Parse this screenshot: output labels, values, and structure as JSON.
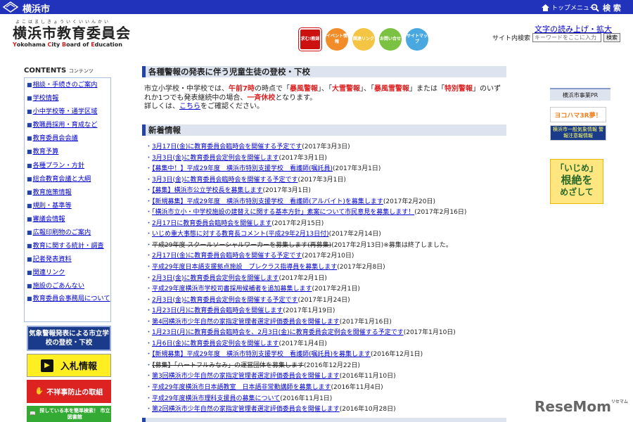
{
  "topbar": {
    "city": "横浜市",
    "top_menu": "トップメニュー",
    "search": "検 索"
  },
  "header": {
    "logo_ruby": "よこはましきょういくいいんかい",
    "logo_title": "横浜市教育委員会",
    "logo_en_1": "Y",
    "logo_en_2": "okohama ",
    "logo_en_3": "C",
    "logo_en_4": "ity ",
    "logo_en_5": "B",
    "logo_en_6": "oard of ",
    "logo_en_7": "E",
    "logo_en_8": "ducation",
    "icons": [
      {
        "label": "求む!教師",
        "color": "#cc1111"
      },
      {
        "label": "イベント情報",
        "color": "#f28c28"
      },
      {
        "label": "関連リンク",
        "color": "#f4c542"
      },
      {
        "label": "お問い合せ",
        "color": "#7cc242"
      },
      {
        "label": "サイトマップ",
        "color": "#4aa8e0"
      }
    ],
    "read_aloud": "文字の読み上げ・拡大",
    "site_search_label": "サイト内検索",
    "site_search_placeholder": "キーワードをここに入力",
    "site_search_button": "検索"
  },
  "left": {
    "contents_title": "CONTENTS",
    "contents_sub": "コンテンツ",
    "nav": [
      "相談・手続きのご案内",
      "学校情報",
      "小中学校等・通学区域",
      "教職員採用・育成など",
      "教育委員会会議",
      "教育予算",
      "各種プラン・方針",
      "総合教育会議と大綱",
      "教育施策情報",
      "規則・基準等",
      "審議会情報",
      "広報印刷物のご案内",
      "教育に関する統計・調査",
      "記者発表資料",
      "関連リンク",
      "施設のごあんない",
      "教育委員会事務局について"
    ],
    "banner_weather": "気象警報発表による市立学校の登校・下校",
    "banner_bid": "入札情報",
    "banner_misconduct": "不祥事防止の取組",
    "banner_library": "探している本を簡単検索！ 市立図書館"
  },
  "main": {
    "heading1": "各種警報の発表に伴う児童生徒の登校・下校",
    "notice": {
      "p1": "市立小学校・中学校では、",
      "p2": "午前7時",
      "p3": "の時点で「",
      "p4": "暴風警報",
      "p5": "」、「",
      "p6": "大雪警報",
      "p7": "」、「",
      "p8": "暴風雪警報",
      "p9": "」または「",
      "p10": "特別警報",
      "p11": "」のいず",
      "p12": "れか1つでも発表継続中の場合、",
      "p13": "一斉休校",
      "p14": "となります。",
      "p15": "詳しくは、",
      "p16": "こちら",
      "p17": "をご確認ください。"
    },
    "heading2": "新着情報",
    "news": [
      {
        "title": "3月17日(金)に教育委員会臨時会を開催する予定です",
        "date": "(2017年3月3日)",
        "del": false
      },
      {
        "title": "3月3日(金)に教育委員会定例会を開催します",
        "date": "(2017年3月1日)",
        "del": false
      },
      {
        "title": "【募集中！】平成29年度　横浜市特別支援学校　看護師(嘱託員)",
        "date": "(2017年3月1日)",
        "del": false
      },
      {
        "title": "3月3日(金)に教育委員会臨時会を開催する予定です",
        "date": "(2017年3月1日)",
        "del": false
      },
      {
        "title": "【募集】横浜市公立学校長を募集します",
        "date": "(2017年3月1日)",
        "del": false
      },
      {
        "title": "【新規募集】平成29年度　横浜市特別支援学校　看護師(アルバイト)を募集します",
        "date": "(2017年2月20日)",
        "del": false
      },
      {
        "title": "「横浜市立小・中学校施設の建替えに関する基本方針」素案について市民意見を募集します！",
        "date": "(2017年2月16日)",
        "del": false
      },
      {
        "title": "2月17日に教育委員会臨時会を開催します",
        "date": "(2017年2月15日)",
        "del": false
      },
      {
        "title": "いじめ重大事態に対する教育長コメント(平成29年2月13日付)",
        "date": "(2017年2月14日)",
        "del": false
      },
      {
        "title": "平成29年度 スクールソーシャルワーカーを募集します(再募集)",
        "date": "(2017年2月13日)※募集は終了しました。",
        "del": true
      },
      {
        "title": "2月17日(金)に教育委員会臨時会を開催する予定です",
        "date": "(2017年2月10日)",
        "del": false
      },
      {
        "title": "平成29年度日本語支援拠点施設　プレクラス指導員を募集します",
        "date": "(2017年2月8日)",
        "del": false
      },
      {
        "title": "2月3日(金)に教育委員会定例会を開催します",
        "date": "(2017年2月1日)",
        "del": false
      },
      {
        "title": "平成29年度横浜市学校司書採用候補者を追加募集します",
        "date": "(2017年2月1日)",
        "del": false
      },
      {
        "title": "2月3日(金)に教育委員会定例会を開催する予定です",
        "date": "(2017年1月24日)",
        "del": false
      },
      {
        "title": "1月23日(月)に教育委員会臨時会を開催します",
        "date": "(2017年1月19日)",
        "del": false
      },
      {
        "title": "第4回横浜市少年自然の家指定管理者選定評価委員会を開催します",
        "date": "(2017年1月16日)",
        "del": false
      },
      {
        "title": "1月23日(月)に教育委員会臨時会を、2月3日(金)に教育委員会定例会を開催する予定です",
        "date": "(2017年1月10日)",
        "del": false
      },
      {
        "title": "1月6日(金)に教育委員会定例会を開催します",
        "date": "(2017年1月4日)",
        "del": false
      },
      {
        "title": "【新規募集】平成29年度　横浜市特別支援学校　看護師(嘱託員)を募集します",
        "date": "(2016年12月1日)",
        "del": false
      },
      {
        "title": "【募集】「ハートフルみなみ」の運営団体を募集します",
        "date": "(2016年12月22日)",
        "del": true
      },
      {
        "title": "第3回横浜市少年自然の家指定管理者選定評価委員会を開催します",
        "date": "(2016年11月10日)",
        "del": false
      },
      {
        "title": "平成29年度横浜市日本語教室　日本語非常勤講師を募集します",
        "date": "(2016年11月4日)",
        "del": false
      },
      {
        "title": "平成29年度横浜市理科支援員の募集について",
        "date": "(2016年11月1日)",
        "del": false
      },
      {
        "title": "第2回横浜市少年自然の家指定管理者選定評価委員会を開催します",
        "date": "(2016年10月28日)",
        "del": false
      }
    ]
  },
  "right": {
    "pr_head": "横浜市事業PR",
    "pr1": "ヨコハマ3R夢！",
    "pr2": "横浜市一般気象情報 警報注意報情報",
    "pr3_line1": "「いじめ」",
    "pr3_line2": "根絶を",
    "pr3_line3": "めざして"
  },
  "watermark": "ReseMom",
  "watermark_small": "リセマム"
}
